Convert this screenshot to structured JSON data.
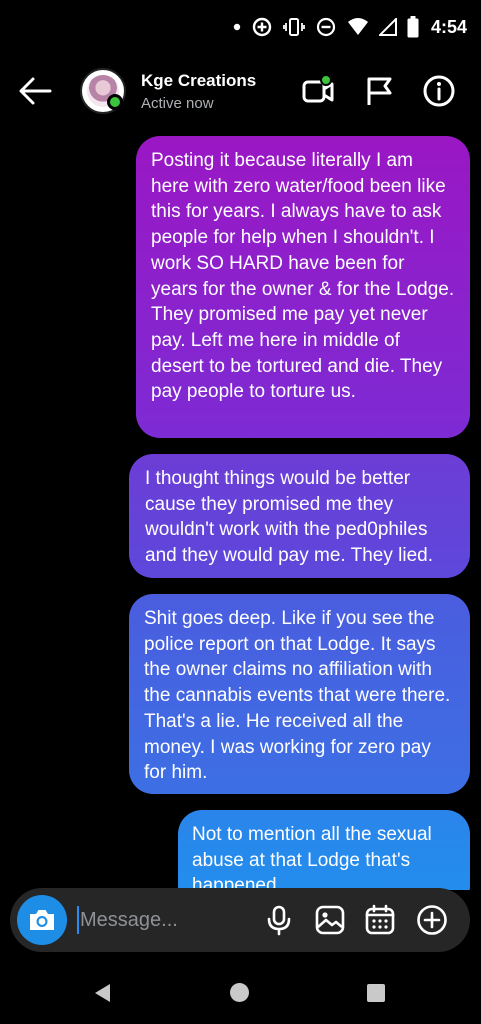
{
  "status_bar": {
    "time": "4:54",
    "icons": [
      "dot-icon",
      "data-saver-icon",
      "vibrate-icon",
      "do-not-disturb-icon",
      "wifi-icon",
      "cell-signal-icon",
      "battery-icon"
    ]
  },
  "header": {
    "contact_name": "Kge Creations",
    "status": "Active now",
    "icons": [
      "back-arrow-icon",
      "video-call-icon",
      "flag-icon",
      "info-icon"
    ],
    "online_color": "#3cc43c"
  },
  "messages": [
    {
      "sender": "me",
      "text": "Posting it because literally I am here with zero water/food been like this for years. I always have to ask people for help when I shouldn't. I work SO HARD have been for years for the owner & for the Lodge. They promised me pay yet never pay. Left me here in middle of desert to be tortured and die. They pay people to torture us."
    },
    {
      "sender": "me",
      "text": "I thought things would be better cause they promised me they wouldn't work with the ped0philes and they would pay me. They lied."
    },
    {
      "sender": "me",
      "text": "Shit goes deep. Like if you see the police report on that Lodge. It says the owner claims no affiliation with the cannabis events that were there. That's a lie. He received all the money. I was working for zero pay for him."
    },
    {
      "sender": "me",
      "text": "Not to mention all the sexual abuse at that Lodge that's happened"
    }
  ],
  "composer": {
    "placeholder": "Message...",
    "value": "",
    "icons": [
      "camera-icon",
      "microphone-icon",
      "gallery-icon",
      "sticker-icon",
      "plus-icon"
    ],
    "accent": "#1d8de6"
  },
  "navbar": {
    "icons": [
      "nav-back-icon",
      "nav-home-icon",
      "nav-recents-icon"
    ]
  }
}
